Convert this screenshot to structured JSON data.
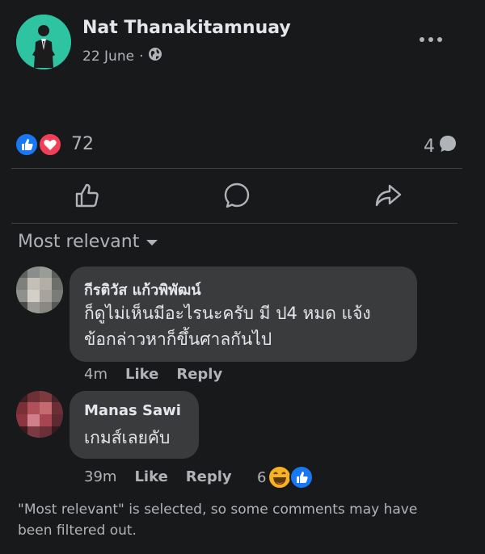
{
  "post": {
    "author": "Nat Thanakitamnuay",
    "date": "22 June",
    "privacy_icon": "globe-icon",
    "more_icon": "more-horizontal-icon"
  },
  "reactions": {
    "count": "72",
    "types": [
      "like",
      "love"
    ],
    "comments_count": "4"
  },
  "actions": [
    {
      "icon": "like-icon"
    },
    {
      "icon": "comment-icon"
    },
    {
      "icon": "share-icon"
    }
  ],
  "filter": {
    "label": "Most relevant"
  },
  "comments": [
    {
      "name": "กีรติวัส แก้วพิพัฒน์",
      "text_line1": "ก็ดูไม่เห็นมีอะไรนะครับ มี ป4 หมด แจ้ง",
      "text_line2": "ข้อกล่าวหาก็ขึ้นศาลกันไป",
      "time": "4m",
      "like": "Like",
      "reply": "Reply"
    },
    {
      "name": "Manas Sawi",
      "text_line1": "เกมส์เลยคับ",
      "time": "39m",
      "like": "Like",
      "reply": "Reply",
      "reaction_count": "6"
    }
  ],
  "notice": "\"Most relevant\" is selected, so some comments may have been filtered out.",
  "colors": {
    "background": "#18191a",
    "bubble": "#3a3b3c",
    "like_blue": "#1877f2",
    "love_red": "#f33e58",
    "text_primary": "#e4e6eb",
    "text_secondary": "#b0b3b8"
  }
}
